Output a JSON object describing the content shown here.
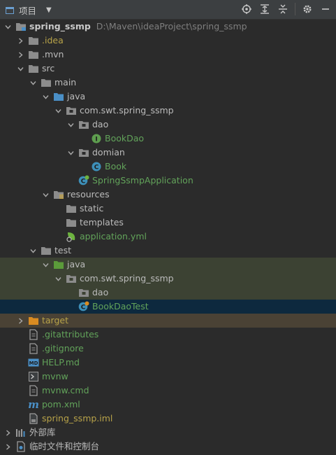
{
  "toolbar": {
    "title": "项目",
    "dropdown_glyph": "▼",
    "tools": [
      "crosshair-icon",
      "expand-all-icon",
      "collapse-all-icon",
      "gear-icon",
      "minimize-icon"
    ]
  },
  "colors": {
    "background": "#2b2b2b",
    "toolbar": "#3c3f41",
    "folder": "#8c8c8c",
    "source_folder": "#4a8fc6",
    "test_folder": "#5b9b3a",
    "excluded_folder": "#d98b21",
    "test_row_bg": "#3c4233",
    "selected_row_bg": "#0d293e",
    "excluded_row_bg": "#4a4235",
    "green_text": "#62a35a"
  },
  "tree": {
    "root": {
      "label": "spring_ssmp",
      "path": "D:\\Maven\\ideaProject\\spring_ssmp"
    },
    "idea": ".idea",
    "mvn": ".mvn",
    "src": "src",
    "main": "main",
    "main_java": "java",
    "pkg": "com.swt.spring_ssmp",
    "dao": "dao",
    "bookdao": "BookDao",
    "domian": "domian",
    "book": "Book",
    "app": "SpringSsmpApplication",
    "resources": "resources",
    "static": "static",
    "templates": "templates",
    "appyml": "application.yml",
    "test": "test",
    "test_java": "java",
    "test_pkg": "com.swt.spring_ssmp",
    "test_dao": "dao",
    "bookdaotest": "BookDaoTest",
    "target": "target",
    "gitattributes": ".gitattributes",
    "gitignore": ".gitignore",
    "help": "HELP.md",
    "mvnw": "mvnw",
    "mvnwcmd": "mvnw.cmd",
    "pom": "pom.xml",
    "iml": "spring_ssmp.iml",
    "extlibs": "外部库",
    "scratches": "临时文件和控制台"
  },
  "icon_letters": {
    "interface": "I",
    "class": "C",
    "markdown": "MD",
    "maven": "m"
  }
}
